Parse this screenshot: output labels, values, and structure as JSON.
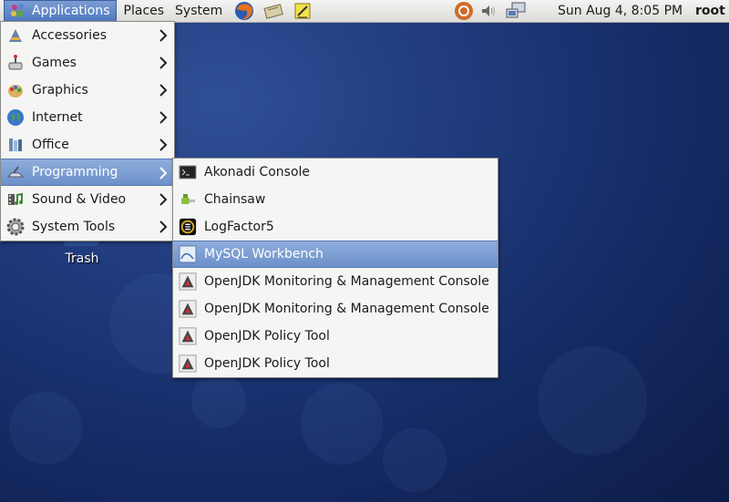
{
  "top_panel": {
    "menus": [
      "Applications",
      "Places",
      "System"
    ],
    "launchers": [
      "firefox-icon",
      "notes-icon",
      "text-editor-icon"
    ],
    "tray_icons": [
      "update-icon",
      "volume-icon",
      "network-icon"
    ],
    "clock": "Sun Aug  4,  8:05 PM",
    "user": "root"
  },
  "desktop": {
    "trash_label": "Trash"
  },
  "applications_menu": {
    "items": [
      {
        "label": "Accessories",
        "icon": "accessories-icon"
      },
      {
        "label": "Games",
        "icon": "games-icon"
      },
      {
        "label": "Graphics",
        "icon": "graphics-icon"
      },
      {
        "label": "Internet",
        "icon": "internet-icon"
      },
      {
        "label": "Office",
        "icon": "office-icon"
      },
      {
        "label": "Programming",
        "icon": "programming-icon",
        "selected": true
      },
      {
        "label": "Sound & Video",
        "icon": "sound-video-icon"
      },
      {
        "label": "System Tools",
        "icon": "system-tools-icon"
      }
    ]
  },
  "programming_menu": {
    "items": [
      {
        "label": "Akonadi Console",
        "icon": "terminal-icon"
      },
      {
        "label": "Chainsaw",
        "icon": "chainsaw-icon"
      },
      {
        "label": "LogFactor5",
        "icon": "logfactor5-icon"
      },
      {
        "label": "MySQL Workbench",
        "icon": "mysql-workbench-icon",
        "selected": true
      },
      {
        "label": "OpenJDK Monitoring & Management Console",
        "icon": "java-icon"
      },
      {
        "label": "OpenJDK Monitoring & Management Console",
        "icon": "java-icon"
      },
      {
        "label": "OpenJDK Policy Tool",
        "icon": "java-icon"
      },
      {
        "label": "OpenJDK Policy Tool",
        "icon": "java-icon"
      }
    ]
  },
  "colors": {
    "highlight": "#7b9cd3",
    "menu_bg": "#f5f5f3",
    "desktop_bg": "#1f3a7c"
  }
}
